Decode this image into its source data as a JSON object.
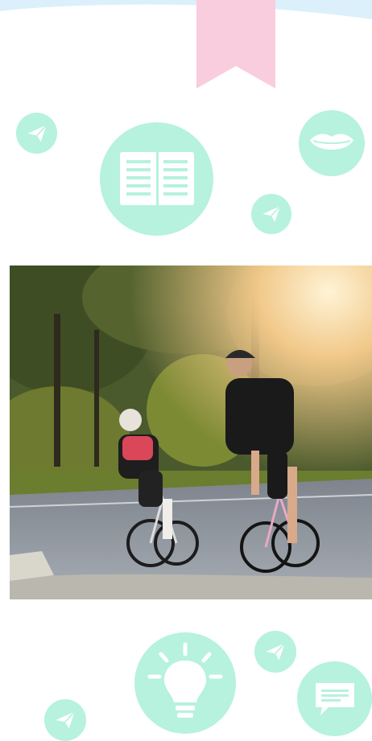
{
  "colors": {
    "mint": "#b6f2dd",
    "pink": "#f9cddd",
    "sky": "#dcf0fb",
    "icon_white": "#ffffff"
  },
  "decor": {
    "icons": [
      "paper-plane-icon",
      "document-icon",
      "lips-icon",
      "lightbulb-icon",
      "chat-bubble-icon",
      "bookmark-ribbon-icon"
    ]
  },
  "photo": {
    "subject": "two-cyclists-road-bikes"
  }
}
